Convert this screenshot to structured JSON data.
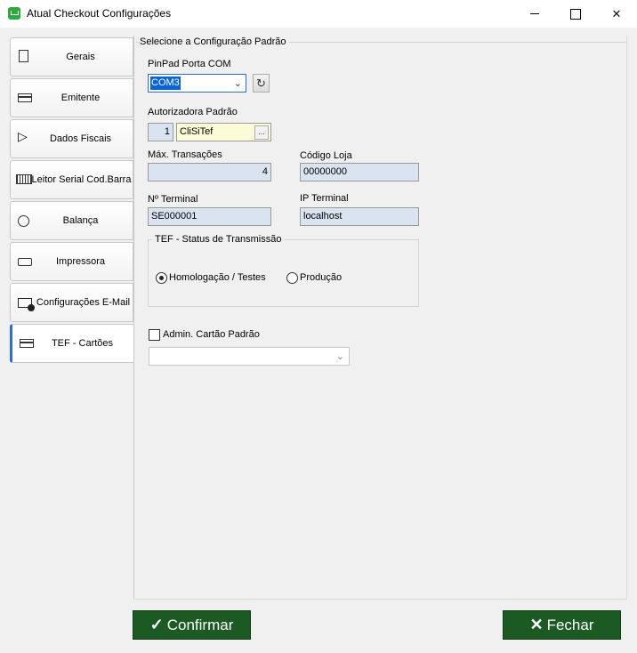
{
  "window": {
    "title": "Atual Checkout Configurações"
  },
  "tabs": [
    {
      "label": "Gerais",
      "icon": "document-icon"
    },
    {
      "label": "Emitente",
      "icon": "card-icon"
    },
    {
      "label": "Dados Fiscais",
      "icon": "flag-icon"
    },
    {
      "label": "Leitor Serial Cod.Barra",
      "icon": "barcode-icon"
    },
    {
      "label": "Balança",
      "icon": "scale-icon"
    },
    {
      "label": "Impressora",
      "icon": "printer-icon"
    },
    {
      "label": "Configurações E-Mail",
      "icon": "mail-icon"
    },
    {
      "label": "TEF - Cartões",
      "icon": "card-icon",
      "active": true
    }
  ],
  "form": {
    "group_title": "Selecione  a Configuração Padrão",
    "pinpad_label": "PinPad Porta COM",
    "pinpad_value": "COM3",
    "autorizadora_label": "Autorizadora Padrão",
    "autorizadora_code": "1",
    "autorizadora_name": "CliSiTef",
    "ellipsis": "...",
    "max_transacoes_label": "Máx. Transações",
    "max_transacoes_value": "4",
    "codigo_loja_label": "Código Loja",
    "codigo_loja_value": "00000000",
    "terminal_label": "Nº Terminal",
    "terminal_value": "SE000001",
    "ip_label": "IP Terminal",
    "ip_value": "localhost",
    "tef_status_title": "TEF - Status de Transmissão",
    "radio_homologacao": "Homologação / Testes",
    "radio_producao": "Produção",
    "selected_status": "homologacao",
    "admin_cartao_label": "Admin. Cartão Padrão",
    "admin_cartao_checked": false,
    "admin_cartao_value": ""
  },
  "footer": {
    "confirm_label": "Confirmar",
    "close_label": "Fechar"
  },
  "colors": {
    "button_green": "#1c5a23",
    "field_blue": "#dae4f0",
    "field_yellow": "#fbfbd8",
    "active_tab_accent": "#2a6fc9"
  }
}
